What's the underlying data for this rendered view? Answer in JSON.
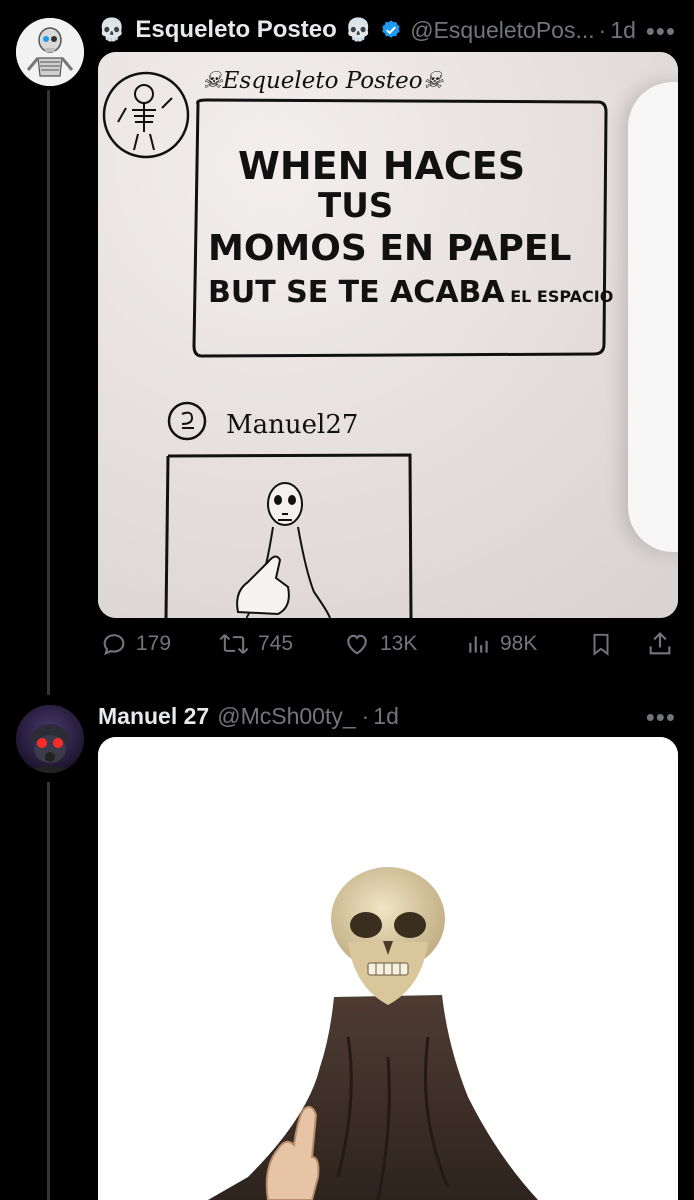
{
  "post1": {
    "display_name": "Esqueleto Posteo",
    "name_emoji": "💀",
    "handle": "@EsqueletoPos...",
    "separator": "·",
    "time": "1d",
    "more": "•••",
    "media": {
      "header_name": "Esqueleto Posteo",
      "caption_lines": [
        "WHEN HACES",
        "TUS",
        "MOMOS EN PAPEL"
      ],
      "caption_last_a": "BUT SE TE ACABA",
      "caption_last_b": "EL ESPACIO",
      "reply_name": "Manuel27"
    },
    "actions": {
      "replies": "179",
      "reposts": "745",
      "likes": "13K",
      "views": "98K"
    }
  },
  "post2": {
    "display_name": "Manuel 27",
    "handle": "@McSh00ty_",
    "separator": "·",
    "time": "1d",
    "more": "•••"
  },
  "colors": {
    "background": "#000000",
    "text_primary": "#e7e9ea",
    "text_secondary": "#71767b",
    "verified_blue": "#1d9bf0",
    "paper": "#ece7e5"
  }
}
